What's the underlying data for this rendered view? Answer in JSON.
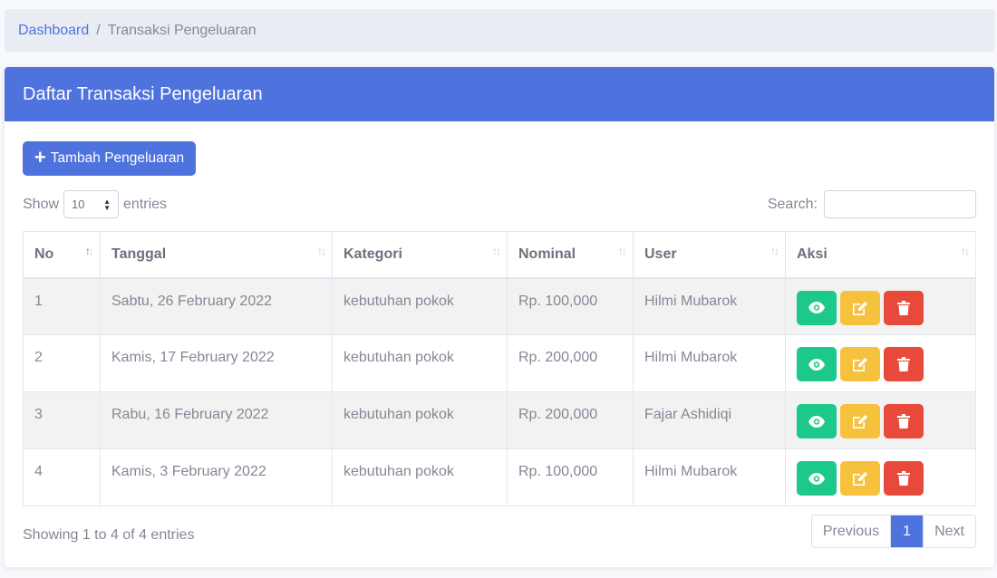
{
  "breadcrumb": {
    "link": "Dashboard",
    "separator": "/",
    "active": "Transaksi Pengeluaran"
  },
  "card": {
    "title": "Daftar Transaksi Pengeluaran",
    "add_button": "Tambah Pengeluaran"
  },
  "length": {
    "show_label": "Show",
    "value": "10",
    "entries_label": "entries"
  },
  "search": {
    "label": "Search:",
    "value": ""
  },
  "table": {
    "columns": [
      "No",
      "Tanggal",
      "Kategori",
      "Nominal",
      "User",
      "Aksi"
    ],
    "rows": [
      {
        "no": "1",
        "tanggal": "Sabtu, 26 February 2022",
        "kategori": "kebutuhan pokok",
        "nominal": "Rp. 100,000",
        "user": "Hilmi Mubarok"
      },
      {
        "no": "2",
        "tanggal": "Kamis, 17 February 2022",
        "kategori": "kebutuhan pokok",
        "nominal": "Rp. 200,000",
        "user": "Hilmi Mubarok"
      },
      {
        "no": "3",
        "tanggal": "Rabu, 16 February 2022",
        "kategori": "kebutuhan pokok",
        "nominal": "Rp. 200,000",
        "user": "Fajar Ashidiqi"
      },
      {
        "no": "4",
        "tanggal": "Kamis, 3 February 2022",
        "kategori": "kebutuhan pokok",
        "nominal": "Rp. 100,000",
        "user": "Hilmi Mubarok"
      }
    ]
  },
  "footer": {
    "info": "Showing 1 to 4 of 4 entries",
    "previous": "Previous",
    "current_page": "1",
    "next": "Next"
  },
  "colors": {
    "primary": "#4e73df",
    "success": "#1cc88a",
    "warning": "#f6c23e",
    "danger": "#e74a3b"
  },
  "icons": {
    "add": "plus-icon",
    "view": "eye-icon",
    "edit": "edit-icon",
    "delete": "trash-icon",
    "sort": "sort-icon"
  }
}
